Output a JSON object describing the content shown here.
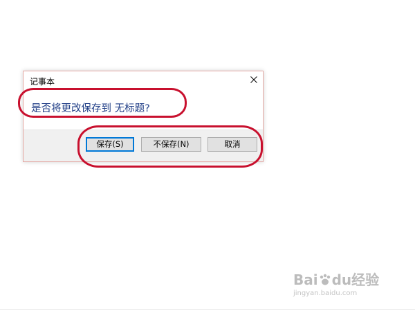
{
  "dialog": {
    "title": "记事本",
    "message": "是否将更改保存到 无标题?",
    "buttons": {
      "save": "保存(S)",
      "dont_save": "不保存(N)",
      "cancel": "取消"
    }
  },
  "watermark": {
    "logo_left": "Bai",
    "logo_mid": "du",
    "logo_right": "经验",
    "url": "jingyan.baidu.com"
  },
  "colors": {
    "annotation": "#c8102e",
    "message_text": "#1f3d86",
    "default_button_border": "#0078d7"
  }
}
